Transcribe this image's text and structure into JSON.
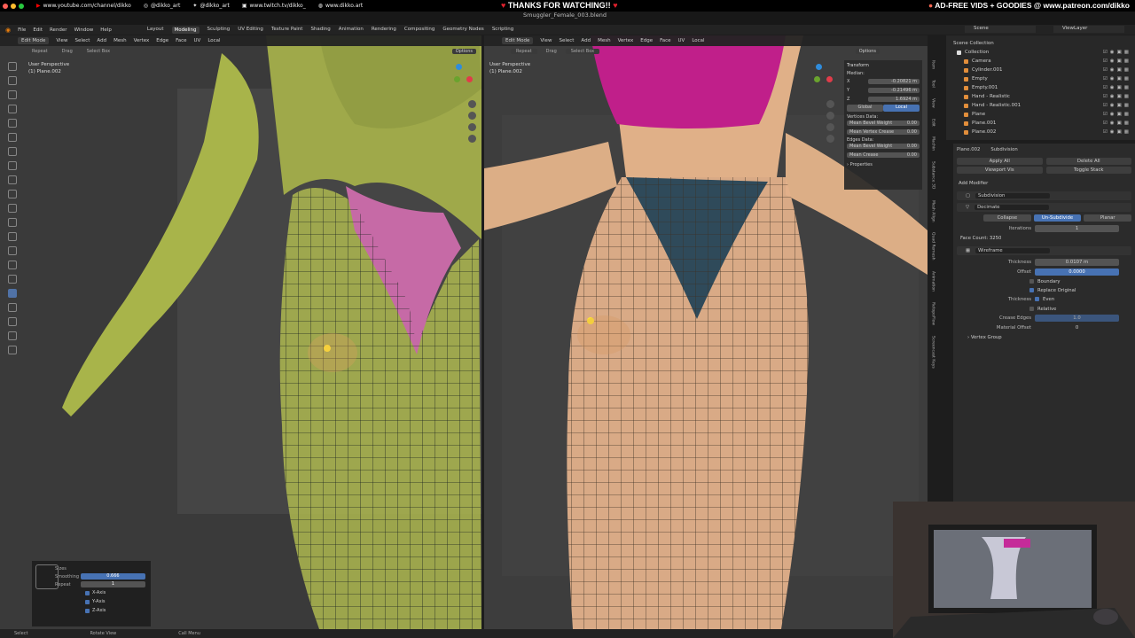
{
  "overlay": {
    "links": [
      "www.youtube.com/channel/dikko",
      "@dikko_art",
      "@dikko_art",
      "www.twitch.tv/dikko_",
      "www.dikko.art"
    ],
    "banner": "THANKS FOR WATCHING!!",
    "patreon": "AD-FREE VIDS + GOODIES @ www.patreon.com/dikko",
    "filename": "Smuggler_Female_003.blend"
  },
  "menus": [
    "File",
    "Edit",
    "Render",
    "Window",
    "Help"
  ],
  "workspaces": [
    "Layout",
    "Modeling",
    "Sculpting",
    "UV Editing",
    "Texture Paint",
    "Shading",
    "Animation",
    "Rendering",
    "Compositing",
    "Geometry Nodes",
    "Scripting"
  ],
  "active_workspace": "Modeling",
  "scene": "Scene",
  "view_layer": "ViewLayer",
  "viewport_left": {
    "mode": "Edit Mode",
    "menu": [
      "View",
      "Select",
      "Add",
      "Mesh",
      "Vertex",
      "Edge",
      "Face",
      "UV"
    ],
    "orientation": "Local",
    "sub": [
      "Repeat",
      "Drag",
      "Select Box"
    ],
    "options": "Options",
    "persp": "User Perspective",
    "object": "(1) Plane.002"
  },
  "viewport_right": {
    "mode": "Edit Mode",
    "menu": [
      "View",
      "Select",
      "Add",
      "Mesh",
      "Vertex",
      "Edge",
      "Face",
      "UV"
    ],
    "orientation": "Local",
    "sub": [
      "Repeat",
      "Drag",
      "Select Box"
    ],
    "options": "Options",
    "persp": "User Perspective",
    "object": "(1) Plane.002"
  },
  "npanel": {
    "title": "Transform",
    "median": "Median:",
    "x_label": "X",
    "x": "-0.20821 m",
    "y_label": "Y",
    "y": "-0.21496 m",
    "z_label": "Z",
    "z": "1.6924 m",
    "global": "Global",
    "local": "Local",
    "vertices_data": "Vertices Data:",
    "mean_bevel_weight_label": "Mean Bevel Weight",
    "mean_bevel_weight": "0.00",
    "mean_vertex_crease_label": "Mean Vertex Crease",
    "mean_vertex_crease": "0.00",
    "edges_data": "Edges Data:",
    "edge_bevel_weight_label": "Mean Bevel Weight",
    "edge_bevel_weight": "0.00",
    "mean_crease_label": "Mean Crease",
    "mean_crease": "0.00",
    "properties": "Properties"
  },
  "sidetabs": [
    "Item",
    "Tool",
    "View",
    "Edit",
    "Machin",
    "Substance 3D",
    "Mesh Align",
    "Quad Remesh",
    "Animation",
    "RetopoFlow",
    "Screencast Keys"
  ],
  "outliner": {
    "collection": "Scene Collection",
    "items": [
      "Collection",
      "Camera",
      "Cylinder.001",
      "Empty",
      "Empty.001",
      "Hand - Realistic",
      "Hand - Realistic.001",
      "Plane",
      "Plane.001",
      "Plane.002"
    ]
  },
  "properties": {
    "object": "Plane.002",
    "modifier_path": "Subdivision",
    "apply_all": "Apply All",
    "delete_all": "Delete All",
    "viewport_vis": "Viewport Vis",
    "toggle_stack": "Toggle Stack",
    "add_modifier": "Add Modifier",
    "mod1": "Subdivision",
    "mod2": "Decimate",
    "decimate_modes": [
      "Collapse",
      "Un-Subdivide",
      "Planar"
    ],
    "iterations_label": "Iterations",
    "iterations": "1",
    "face_count": "Face Count: 3250",
    "mod3": "Wireframe",
    "thickness_label": "Thickness",
    "thickness": "0.0107 m",
    "offset_label": "Offset",
    "offset": "0.0000",
    "boundary": "Boundary",
    "replace_original": "Replace Original",
    "thickness2_label": "Thickness",
    "even": "Even",
    "relative": "Relative",
    "crease_edges_label": "Crease Edges",
    "crease_edges": "1.0",
    "material_offset_label": "Material Offset",
    "material_offset": "0",
    "vertex_group": "Vertex Group"
  },
  "redo": {
    "title": "Sizes",
    "smoothing_label": "Smoothing",
    "smoothing": "0.666",
    "repeat_label": "Repeat",
    "repeat": "1",
    "axes": [
      "X-Axis",
      "Y-Axis",
      "Z-Axis"
    ]
  },
  "status": [
    "Select",
    "Rotate View",
    "Call Menu"
  ],
  "colors": {
    "accent": "#4772b3",
    "body_green": "#a8b44a",
    "body_skin": "#e2b08a",
    "bikini_pink": "#c85ea6",
    "top_magenta": "#c6208c"
  }
}
